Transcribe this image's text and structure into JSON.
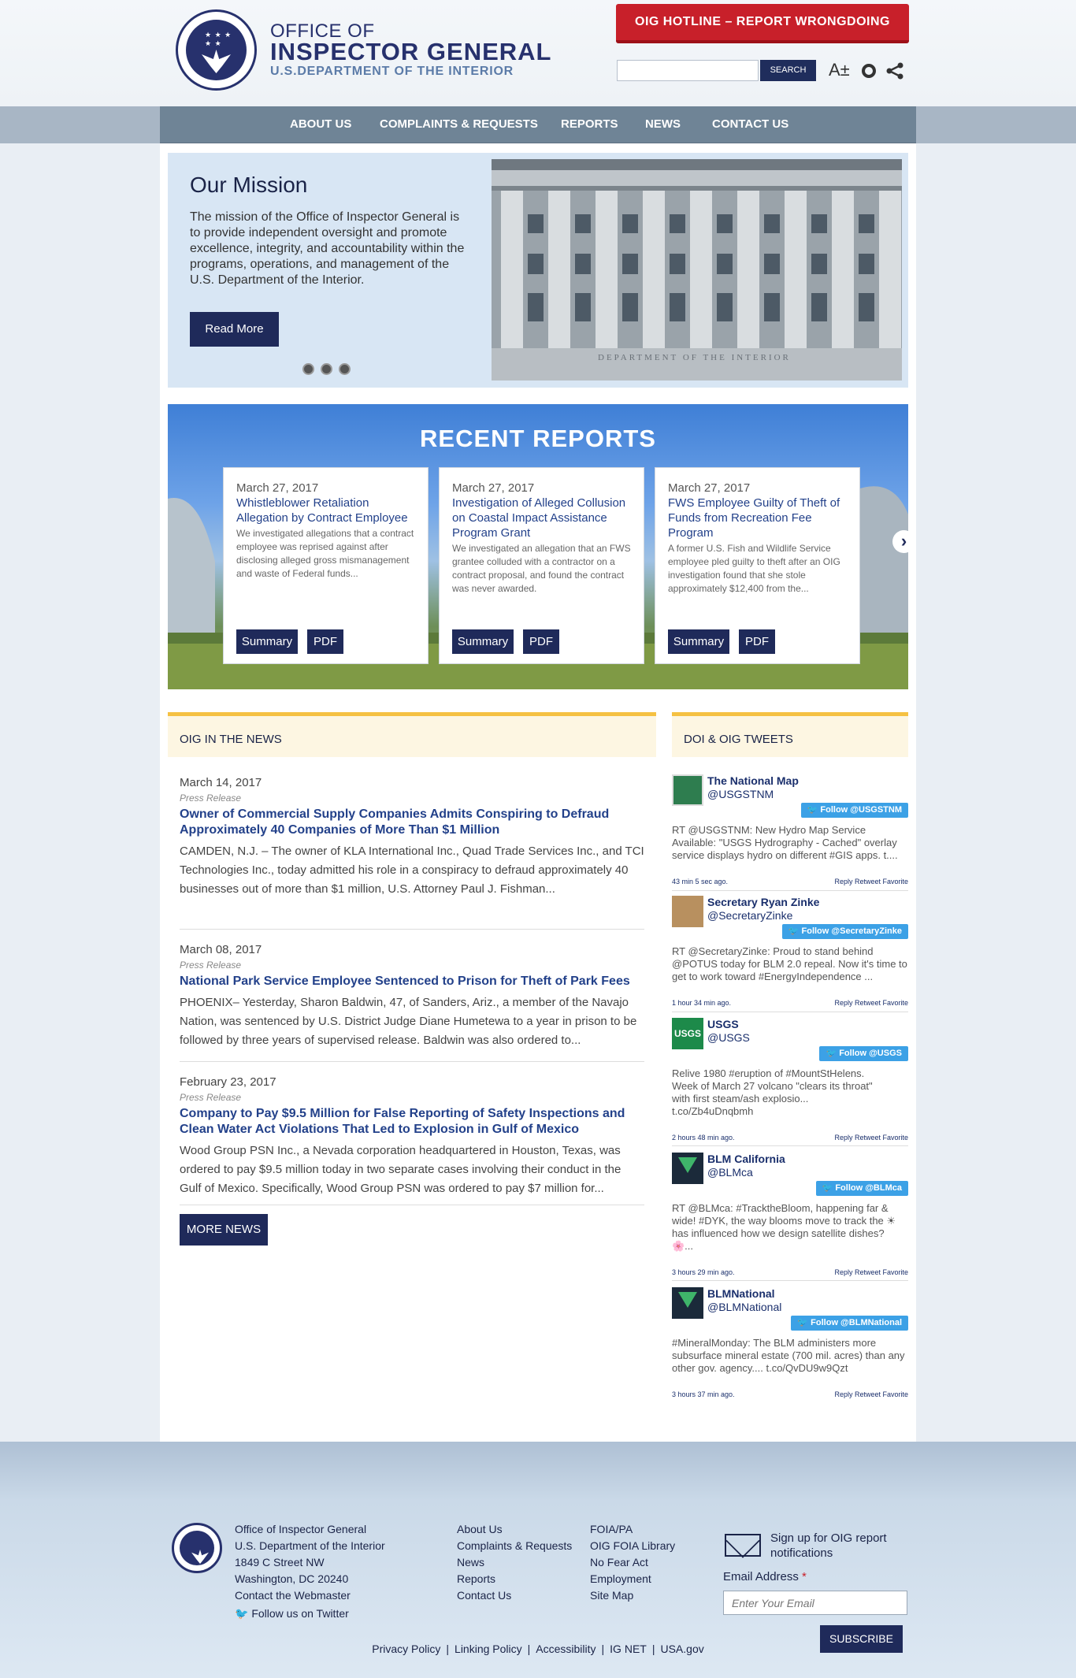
{
  "header": {
    "logo_line1": "OFFICE OF",
    "logo_line2": "INSPECTOR GENERAL",
    "logo_line3": "U.S.DEPARTMENT OF THE INTERIOR",
    "hotline": "OIG HOTLINE – REPORT WRONGDOING",
    "search_button": "SEARCH",
    "font_size_icon": "A±"
  },
  "nav": [
    "ABOUT US",
    "COMPLAINTS & REQUESTS",
    "REPORTS",
    "NEWS",
    "CONTACT US"
  ],
  "hero": {
    "title": "Our Mission",
    "text": "The mission of the Office of Inspector General is to provide independent oversight and promote excellence, integrity, and accountability within the programs, operations, and management of the U.S. Department of the Interior.",
    "button": "Read More",
    "image_caption": "DEPARTMENT OF THE INTERIOR"
  },
  "reports": {
    "title": "RECENT REPORTS",
    "cards": [
      {
        "date": "March 27, 2017",
        "title": "Whistleblower Retaliation Allegation by Contract Employee",
        "desc": "We investigated allegations that a contract employee was reprised against after disclosing alleged gross mismanagement and waste of Federal funds...",
        "summary": "Summary",
        "pdf": "PDF"
      },
      {
        "date": "March 27, 2017",
        "title": "Investigation of Alleged Collusion on Coastal Impact Assistance Program Grant",
        "desc": "We investigated an allegation that an FWS grantee colluded with a contractor on a contract proposal, and found the contract was never awarded.",
        "summary": "Summary",
        "pdf": "PDF"
      },
      {
        "date": "March 27, 2017",
        "title": "FWS Employee Guilty of Theft of Funds from Recreation Fee Program",
        "desc": "A former U.S. Fish and Wildlife Service employee pled guilty to theft after an OIG investigation found that she stole approximately $12,400 from the...",
        "summary": "Summary",
        "pdf": "PDF"
      }
    ]
  },
  "news": {
    "heading": "OIG IN THE NEWS",
    "items": [
      {
        "date": "March 14, 2017",
        "type": "Press Release",
        "title": "Owner of Commercial Supply Companies Admits Conspiring to Defraud Approximately 40 Companies of More Than $1 Million",
        "body": "CAMDEN, N.J. – The owner of KLA International Inc., Quad Trade Services Inc., and TCI Technologies Inc., today admitted his role in a conspiracy to defraud approximately 40 businesses out of more than $1 million, U.S. Attorney Paul J. Fishman..."
      },
      {
        "date": "March 08, 2017",
        "type": "Press Release",
        "title": "National Park Service Employee Sentenced to Prison for Theft of Park Fees",
        "body": "PHOENIX– Yesterday, Sharon Baldwin, 47, of Sanders, Ariz., a member of the Navajo Nation, was sentenced by U.S. District Judge Diane Humetewa to a year in prison to be followed by three years of supervised release. Baldwin was also ordered to..."
      },
      {
        "date": "February 23, 2017",
        "type": "Press Release",
        "title": "Company to Pay $9.5 Million for False Reporting of Safety Inspections and Clean Water Act Violations That Led to Explosion in Gulf of Mexico",
        "body": "Wood Group PSN Inc., a Nevada corporation headquartered in Houston, Texas, was ordered to pay $9.5 million today in two separate cases involving their conduct in the Gulf of Mexico. Specifically, Wood Group PSN was ordered to pay $7 million for..."
      }
    ],
    "more": "MORE NEWS"
  },
  "tweets": {
    "heading": "DOI & OIG TWEETS",
    "items": [
      {
        "name": "The National Map",
        "handle": "@USGSTNM",
        "follow": "Follow @USGSTNM",
        "text": "RT @USGSTNM: New Hydro Map Service Available: \"USGS Hydrography - Cached\" overlay service displays hydro on different #GIS apps. t....",
        "ago": "43 min 5 sec ago.",
        "actions": "Reply Retweet Favorite",
        "color": "#2e7d4f"
      },
      {
        "name": "Secretary Ryan Zinke",
        "handle": "@SecretaryZinke",
        "follow": "Follow @SecretaryZinke",
        "text": "RT @SecretaryZinke: Proud to stand behind @POTUS today for BLM 2.0 repeal. Now it's time to get to work toward #EnergyIndependence ...",
        "ago": "1 hour 34 min ago.",
        "actions": "Reply Retweet Favorite",
        "color": "#b8905f"
      },
      {
        "name": "USGS",
        "handle": "@USGS",
        "follow": "Follow @USGS",
        "text": "Relive 1980 #eruption of #MountStHelens. Week of March 27 volcano \"clears its throat\" with first steam/ash explosio... t.co/Zb4uDnqbmh",
        "ago": "2 hours 48 min ago.",
        "actions": "Reply Retweet Favorite",
        "color": "#1d8a4a"
      },
      {
        "name": "BLM California",
        "handle": "@BLMca",
        "follow": "Follow @BLMca",
        "text": "RT @BLMca: #TracktheBloom, happening far & wide! #DYK, the way blooms move to track the ☀ has influenced how we design satellite dishes? 🌸...",
        "ago": "3 hours 29 min ago.",
        "actions": "Reply Retweet Favorite",
        "color": "#1b2a3a"
      },
      {
        "name": "BLMNational",
        "handle": "@BLMNational",
        "follow": "Follow @BLMNational",
        "text": "#MineralMonday: The BLM administers more subsurface mineral estate (700 mil. acres) than any other gov. agency.... t.co/QvDU9w9Qzt",
        "ago": "3 hours 37 min ago.",
        "actions": "Reply Retweet Favorite",
        "color": "#1b2a3a"
      }
    ]
  },
  "footer": {
    "address": [
      "Office of Inspector General",
      "U.S. Department of the Interior",
      "1849 C Street NW",
      "Washington, DC 20240",
      "Contact the Webmaster"
    ],
    "twitter": "Follow us on Twitter",
    "col2": [
      "About Us",
      "Complaints & Requests",
      "News",
      "Reports",
      "Contact Us"
    ],
    "col3": [
      "FOIA/PA",
      "OIG FOIA Library",
      "No Fear Act",
      "Employment",
      "Site Map"
    ],
    "signup": "Sign up for OIG report notifications",
    "email_label": "Email Address",
    "email_placeholder": "Enter Your Email",
    "subscribe": "SUBSCRIBE",
    "bottom": [
      "Privacy Policy",
      "Linking Policy",
      "Accessibility",
      "IG NET",
      "USA.gov"
    ]
  }
}
